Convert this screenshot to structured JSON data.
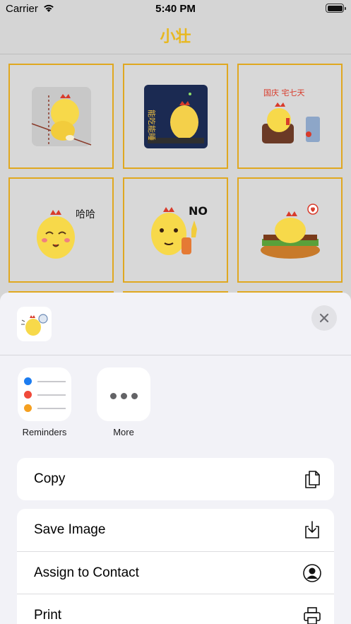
{
  "status_bar": {
    "carrier": "Carrier",
    "time": "5:40 PM"
  },
  "nav": {
    "title": "小壮"
  },
  "stickers": [
    {
      "name": "sticker-wall-peek"
    },
    {
      "name": "sticker-night-sleep",
      "caption": "能吃能睡"
    },
    {
      "name": "sticker-holiday-tv",
      "caption": "国庆 宅七天"
    },
    {
      "name": "sticker-laugh",
      "caption": "哈哈"
    },
    {
      "name": "sticker-no",
      "caption": "NO"
    },
    {
      "name": "sticker-burger"
    }
  ],
  "share_sheet": {
    "apps": [
      {
        "label": "Reminders",
        "icon": "reminders-icon"
      },
      {
        "label": "More",
        "icon": "more-icon"
      }
    ],
    "primary_actions": [
      {
        "label": "Copy",
        "icon": "copy-icon"
      }
    ],
    "actions": [
      {
        "label": "Save Image",
        "icon": "save-image-icon"
      },
      {
        "label": "Assign to Contact",
        "icon": "contact-icon"
      },
      {
        "label": "Print",
        "icon": "printer-icon"
      }
    ]
  },
  "colors": {
    "accent": "#e8b820",
    "cell_border": "#e0a820",
    "sheet_bg": "#f2f2f7"
  }
}
